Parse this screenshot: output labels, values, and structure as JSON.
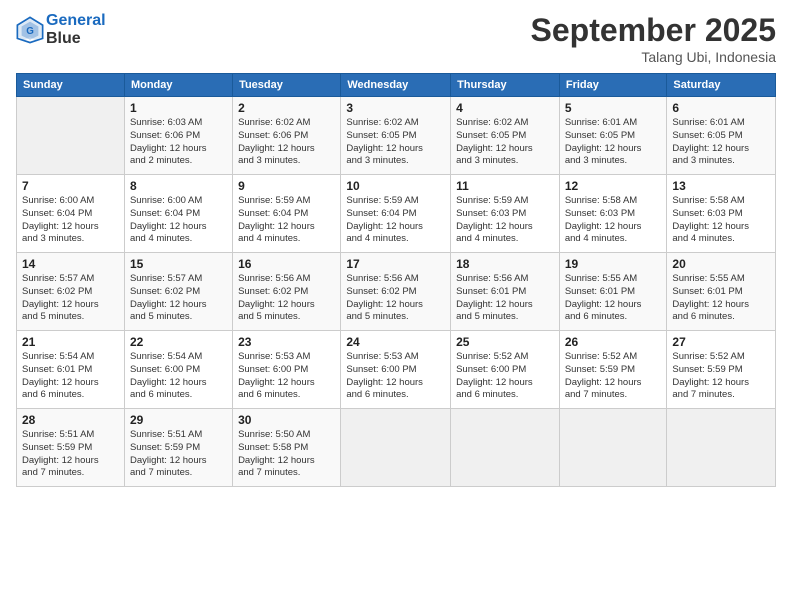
{
  "header": {
    "logo_line1": "General",
    "logo_line2": "Blue",
    "title": "September 2025",
    "subtitle": "Talang Ubi, Indonesia"
  },
  "days_of_week": [
    "Sunday",
    "Monday",
    "Tuesday",
    "Wednesday",
    "Thursday",
    "Friday",
    "Saturday"
  ],
  "weeks": [
    [
      {
        "day": "",
        "info": ""
      },
      {
        "day": "1",
        "info": "Sunrise: 6:03 AM\nSunset: 6:06 PM\nDaylight: 12 hours\nand 2 minutes."
      },
      {
        "day": "2",
        "info": "Sunrise: 6:02 AM\nSunset: 6:06 PM\nDaylight: 12 hours\nand 3 minutes."
      },
      {
        "day": "3",
        "info": "Sunrise: 6:02 AM\nSunset: 6:05 PM\nDaylight: 12 hours\nand 3 minutes."
      },
      {
        "day": "4",
        "info": "Sunrise: 6:02 AM\nSunset: 6:05 PM\nDaylight: 12 hours\nand 3 minutes."
      },
      {
        "day": "5",
        "info": "Sunrise: 6:01 AM\nSunset: 6:05 PM\nDaylight: 12 hours\nand 3 minutes."
      },
      {
        "day": "6",
        "info": "Sunrise: 6:01 AM\nSunset: 6:05 PM\nDaylight: 12 hours\nand 3 minutes."
      }
    ],
    [
      {
        "day": "7",
        "info": "Sunrise: 6:00 AM\nSunset: 6:04 PM\nDaylight: 12 hours\nand 3 minutes."
      },
      {
        "day": "8",
        "info": "Sunrise: 6:00 AM\nSunset: 6:04 PM\nDaylight: 12 hours\nand 4 minutes."
      },
      {
        "day": "9",
        "info": "Sunrise: 5:59 AM\nSunset: 6:04 PM\nDaylight: 12 hours\nand 4 minutes."
      },
      {
        "day": "10",
        "info": "Sunrise: 5:59 AM\nSunset: 6:04 PM\nDaylight: 12 hours\nand 4 minutes."
      },
      {
        "day": "11",
        "info": "Sunrise: 5:59 AM\nSunset: 6:03 PM\nDaylight: 12 hours\nand 4 minutes."
      },
      {
        "day": "12",
        "info": "Sunrise: 5:58 AM\nSunset: 6:03 PM\nDaylight: 12 hours\nand 4 minutes."
      },
      {
        "day": "13",
        "info": "Sunrise: 5:58 AM\nSunset: 6:03 PM\nDaylight: 12 hours\nand 4 minutes."
      }
    ],
    [
      {
        "day": "14",
        "info": "Sunrise: 5:57 AM\nSunset: 6:02 PM\nDaylight: 12 hours\nand 5 minutes."
      },
      {
        "day": "15",
        "info": "Sunrise: 5:57 AM\nSunset: 6:02 PM\nDaylight: 12 hours\nand 5 minutes."
      },
      {
        "day": "16",
        "info": "Sunrise: 5:56 AM\nSunset: 6:02 PM\nDaylight: 12 hours\nand 5 minutes."
      },
      {
        "day": "17",
        "info": "Sunrise: 5:56 AM\nSunset: 6:02 PM\nDaylight: 12 hours\nand 5 minutes."
      },
      {
        "day": "18",
        "info": "Sunrise: 5:56 AM\nSunset: 6:01 PM\nDaylight: 12 hours\nand 5 minutes."
      },
      {
        "day": "19",
        "info": "Sunrise: 5:55 AM\nSunset: 6:01 PM\nDaylight: 12 hours\nand 6 minutes."
      },
      {
        "day": "20",
        "info": "Sunrise: 5:55 AM\nSunset: 6:01 PM\nDaylight: 12 hours\nand 6 minutes."
      }
    ],
    [
      {
        "day": "21",
        "info": "Sunrise: 5:54 AM\nSunset: 6:01 PM\nDaylight: 12 hours\nand 6 minutes."
      },
      {
        "day": "22",
        "info": "Sunrise: 5:54 AM\nSunset: 6:00 PM\nDaylight: 12 hours\nand 6 minutes."
      },
      {
        "day": "23",
        "info": "Sunrise: 5:53 AM\nSunset: 6:00 PM\nDaylight: 12 hours\nand 6 minutes."
      },
      {
        "day": "24",
        "info": "Sunrise: 5:53 AM\nSunset: 6:00 PM\nDaylight: 12 hours\nand 6 minutes."
      },
      {
        "day": "25",
        "info": "Sunrise: 5:52 AM\nSunset: 6:00 PM\nDaylight: 12 hours\nand 6 minutes."
      },
      {
        "day": "26",
        "info": "Sunrise: 5:52 AM\nSunset: 5:59 PM\nDaylight: 12 hours\nand 7 minutes."
      },
      {
        "day": "27",
        "info": "Sunrise: 5:52 AM\nSunset: 5:59 PM\nDaylight: 12 hours\nand 7 minutes."
      }
    ],
    [
      {
        "day": "28",
        "info": "Sunrise: 5:51 AM\nSunset: 5:59 PM\nDaylight: 12 hours\nand 7 minutes."
      },
      {
        "day": "29",
        "info": "Sunrise: 5:51 AM\nSunset: 5:59 PM\nDaylight: 12 hours\nand 7 minutes."
      },
      {
        "day": "30",
        "info": "Sunrise: 5:50 AM\nSunset: 5:58 PM\nDaylight: 12 hours\nand 7 minutes."
      },
      {
        "day": "",
        "info": ""
      },
      {
        "day": "",
        "info": ""
      },
      {
        "day": "",
        "info": ""
      },
      {
        "day": "",
        "info": ""
      }
    ]
  ]
}
